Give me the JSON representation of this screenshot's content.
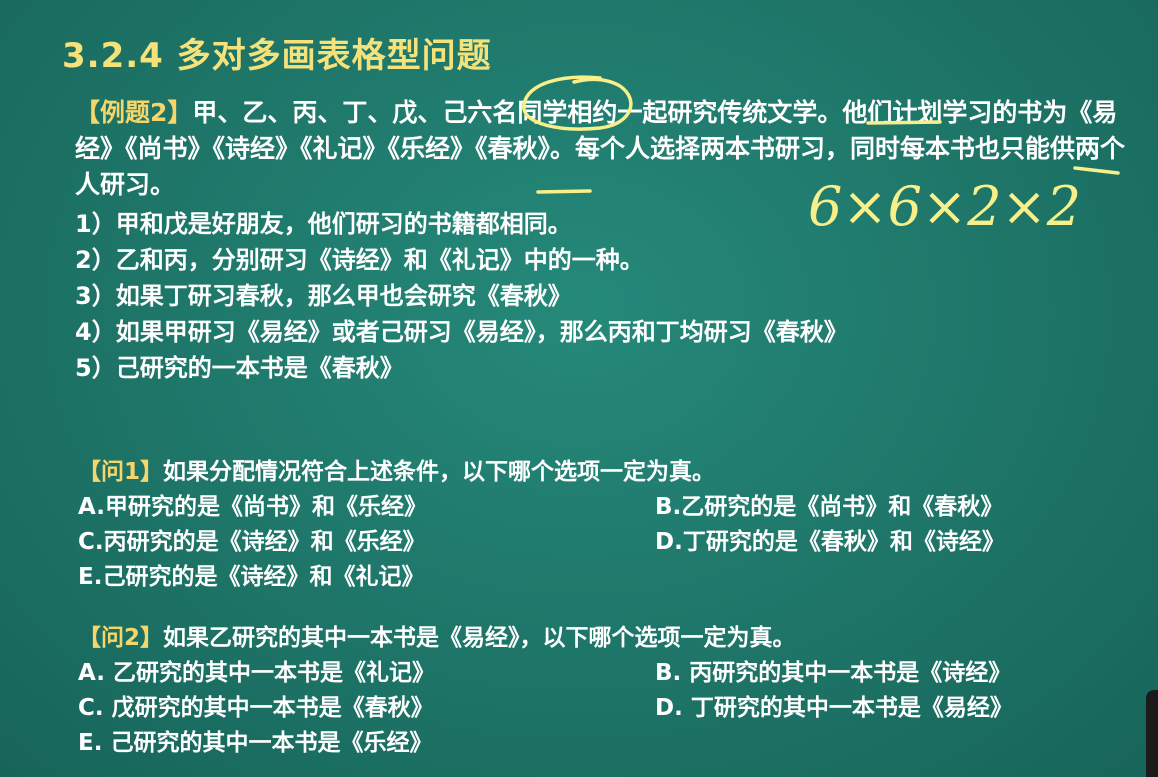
{
  "title": "3.2.4 多对多画表格型问题",
  "intro": {
    "tag": "【例题2】",
    "text": "甲、乙、丙、丁、戊、己六名同学相约一起研究传统文学。他们计划学习的书为《易经》《尚书》《诗经》《礼记》《乐经》《春秋》。每个人选择两本书研习，同时每本书也只能供两个人研习。"
  },
  "conditions": [
    "1）甲和戊是好朋友，他们研习的书籍都相同。",
    "2）乙和丙，分别研习《诗经》和《礼记》中的一种。",
    "3）如果丁研习春秋，那么甲也会研究《春秋》",
    "4）如果甲研习《易经》或者己研习《易经》，那么丙和丁均研习《春秋》",
    "5）己研究的一本书是《春秋》"
  ],
  "handwriting": "6×6×2×2",
  "question1": {
    "tag": "【问1】",
    "text": "如果分配情况符合上述条件，以下哪个选项一定为真。",
    "options": {
      "a": "A.甲研究的是《尚书》和《乐经》",
      "b": "B.乙研究的是《尚书》和《春秋》",
      "c": "C.丙研究的是《诗经》和《乐经》",
      "d": "D.丁研究的是《春秋》和《诗经》",
      "e": "E.己研究的是《诗经》和《礼记》"
    }
  },
  "question2": {
    "tag": "【问2】",
    "text": "如果乙研究的其中一本书是《易经》，以下哪个选项一定为真。",
    "options": {
      "a": "A. 乙研究的其中一本书是《礼记》",
      "b": "B. 丙研究的其中一本书是《诗经》",
      "c": "C. 戊研究的其中一本书是《春秋》",
      "d": "D. 丁研究的其中一本书是《易经》",
      "e": "E. 己研究的其中一本书是《乐经》"
    }
  },
  "colors": {
    "background": "#1f7a6d",
    "title": "#f6e27a",
    "tag": "#f6d66b",
    "ink": "#f7ef8a"
  }
}
